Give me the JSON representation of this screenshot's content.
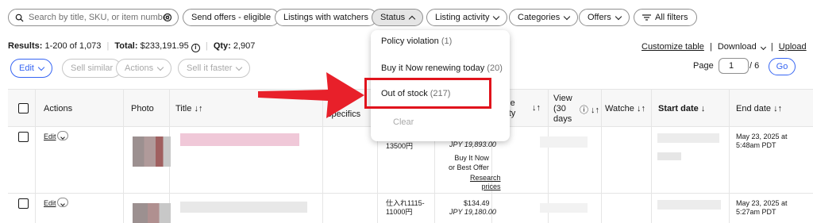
{
  "filters": {
    "search_placeholder": "Search by title, SKU, or item number",
    "send_offers": "Send offers - eligible",
    "listings_with_watchers": "Listings with watchers",
    "status": "Status",
    "listing_activity": "Listing activity",
    "categories": "Categories",
    "offers": "Offers",
    "all_filters": "All filters"
  },
  "summary": {
    "results_label": "Results:",
    "results_value": "1-200 of 1,073",
    "total_label": "Total:",
    "total_value": "$233,191.95",
    "qty_label": "Qty:",
    "qty_value": "2,907"
  },
  "toolbar": {
    "edit": "Edit",
    "sell_similar": "Sell similar",
    "actions": "Actions",
    "sell_faster": "Sell it faster",
    "customize_table": "Customize table",
    "download": "Download",
    "upload": "Upload",
    "page_label": "Page",
    "page_value": "1",
    "page_total": "/ 6",
    "go": "Go"
  },
  "table": {
    "headers": {
      "actions": "Actions",
      "photo": "Photo",
      "title": "Title",
      "specifics": "specifics",
      "available_qty": "ilable\nantity",
      "views": "View\n(30\ndays",
      "watchers": "Watche",
      "start_date": "Start date",
      "end_date": "End date"
    },
    "rows": [
      {
        "edit": "Edit",
        "custom_label": "13500円",
        "price_jpy": "JPY 19,893.00",
        "format": "Buy It Now\nor Best Offer",
        "research": "Research\nprices",
        "end_date": "May 23, 2025 at\n5:48am PDT"
      },
      {
        "edit": "Edit",
        "custom_label": "仕入れ1115-\n11000円",
        "price": "$134.49",
        "price_jpy": "JPY 19,180.00",
        "end_date": "May 23, 2025 at\n5:27am PDT"
      }
    ]
  },
  "status_dropdown": {
    "items": [
      {
        "label": "Policy violation",
        "count": "(1)"
      },
      {
        "label": "Buy it Now renewing today",
        "count": "(20)"
      },
      {
        "label": "Out of stock",
        "count": "(217)"
      }
    ],
    "clear": "Clear"
  },
  "colors": {
    "accent_blue": "#3665f3",
    "highlight_red": "#e0131c",
    "arrow_red": "#e8202a"
  }
}
